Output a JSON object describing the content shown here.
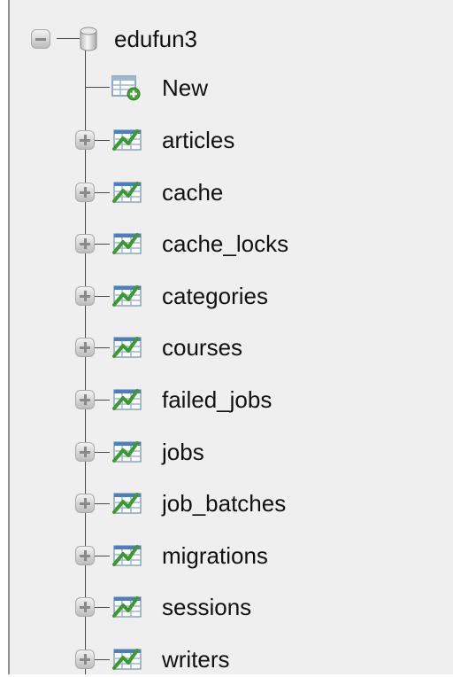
{
  "database": {
    "name": "edufun3",
    "icon": "database-icon",
    "expanded": true
  },
  "new_item": {
    "label": "New",
    "icon": "new-table-icon"
  },
  "tables": [
    {
      "name": "articles",
      "icon": "table-icon"
    },
    {
      "name": "cache",
      "icon": "table-icon"
    },
    {
      "name": "cache_locks",
      "icon": "table-icon"
    },
    {
      "name": "categories",
      "icon": "table-icon"
    },
    {
      "name": "courses",
      "icon": "table-icon"
    },
    {
      "name": "failed_jobs",
      "icon": "table-icon"
    },
    {
      "name": "jobs",
      "icon": "table-icon"
    },
    {
      "name": "job_batches",
      "icon": "table-icon"
    },
    {
      "name": "migrations",
      "icon": "table-icon"
    },
    {
      "name": "sessions",
      "icon": "table-icon"
    },
    {
      "name": "writers",
      "icon": "table-icon"
    }
  ],
  "colors": {
    "tree_background": "#efefef",
    "connector": "#4a4a4a",
    "table_icon_green": "#3a9a2a",
    "table_icon_blue": "#4a7fc0"
  }
}
